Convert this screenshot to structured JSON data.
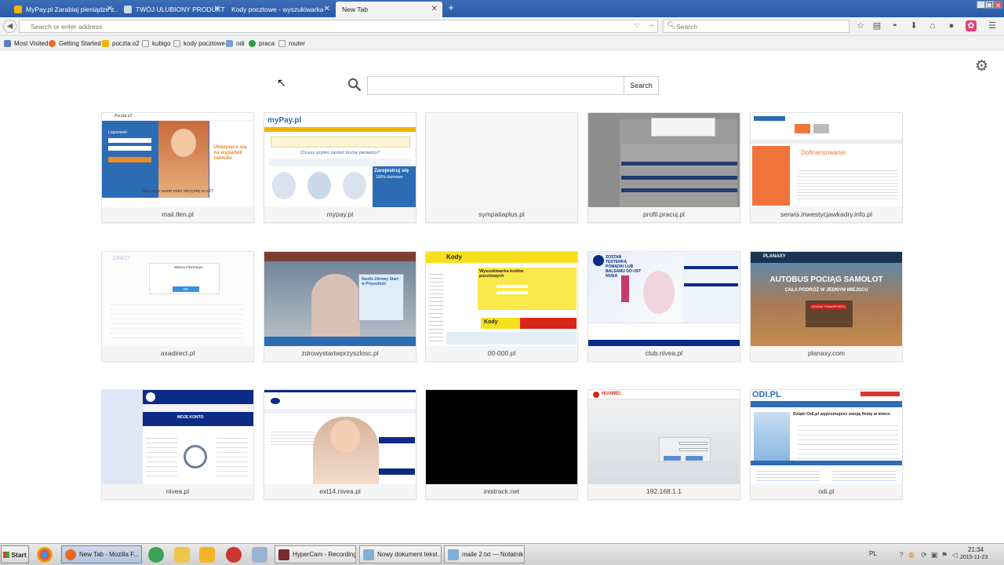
{
  "tabs": [
    {
      "label": "MyPay.pl Zarabiaj pieniądze z..."
    },
    {
      "label": "TWÓJ ULUBIONY PRODUKT A..."
    },
    {
      "label": "Kody pocztowe - wyszukiwarka"
    },
    {
      "label": "New Tab"
    }
  ],
  "address_bar": {
    "placeholder": "Search or enter address"
  },
  "search_bar": {
    "placeholder": "Search"
  },
  "bookmarks": [
    {
      "label": "Most Visited"
    },
    {
      "label": "Getting Started"
    },
    {
      "label": "poczta o2"
    },
    {
      "label": "kubigo"
    },
    {
      "label": "kody pocztowe"
    },
    {
      "label": "odi"
    },
    {
      "label": "praca"
    },
    {
      "label": "router"
    }
  ],
  "newtab": {
    "search_button": "Search",
    "tiles": [
      {
        "label": "mail.tlen.pl"
      },
      {
        "label": "mypay.pl"
      },
      {
        "label": "sympatiaplus.pl"
      },
      {
        "label": "profil.pracuj.pl"
      },
      {
        "label": "serwis.inwestycjawkadry.info.pl"
      },
      {
        "label": "axadirect.pl"
      },
      {
        "label": "zdrowystartwprzyszlosc.pl"
      },
      {
        "label": "00-000.pl"
      },
      {
        "label": "club.nivea.pl"
      },
      {
        "label": "planaxy.com"
      },
      {
        "label": "nivea.pl"
      },
      {
        "label": "ext14.nivea.pl"
      },
      {
        "label": "inistrack.net"
      },
      {
        "label": "192.168.1.1"
      },
      {
        "label": "odi.pl"
      }
    ]
  },
  "thumb_text": {
    "poczta": "Poczta o2",
    "logowanie": "Logowanie",
    "ubezpiecz": "Ubezpiecz się na wypadek zawodu",
    "dlaczego": "Dlaczego warto mieć skrzynkę w o2?",
    "mypay_logo": "myPay.pl",
    "mypay_q": "Chcesz szybko zarobić trochę pieniędzy?",
    "zarejestruj": "Zarejestruj się",
    "darmowe": "100% darmowe",
    "dofinansowanie": "Dofinansowanie",
    "kody": "Kody",
    "wyszukiwarka": "Wyszukiwarka kodów pocztowych",
    "kody_banner": "Kody",
    "nivea_head": "ZOSTAŃ TESTERKĄ POMADKI LUB BALSAMU DO UST NIVEA",
    "planaxy": "PLANAXY",
    "autobus": "AUTOBUS  POCIĄG  SAMOLOT",
    "cala": "CAŁA PODRÓŻ W JEDNYM MIEJSCU",
    "szukaj": "SZUKAJ TRANSPORTU",
    "moje_konto": "MOJE KONTO",
    "huawei": "HUAWEI",
    "odi_logo": "ODI.PL",
    "odi_head": "Dzięki Odi.pl wypromujesz swoją firmę w intern",
    "direct": "DIRECT",
    "wazna": "Ważna informacja",
    "ok": "OK",
    "nestle": "Nestle Zdrowy Start w Przyszłość"
  },
  "taskbar": {
    "start_label": "Start",
    "tasks": [
      {
        "label": "New Tab - Mozilla F..."
      },
      {
        "label": "HyperCam - Recording"
      },
      {
        "label": "Nowy dokument tekst..."
      },
      {
        "label": "maile 2.txt — Notatnik"
      }
    ],
    "lang": "PL",
    "time": "21:34",
    "date": "2015-11-23"
  },
  "colors": {
    "tab_strip": "#2f5fae",
    "o2_blue": "#2b6cb5",
    "orange": "#f08a24",
    "nivea_blue": "#0b2b84",
    "kody_yellow": "#f7e01b",
    "planaxy_red": "#c4221f"
  }
}
